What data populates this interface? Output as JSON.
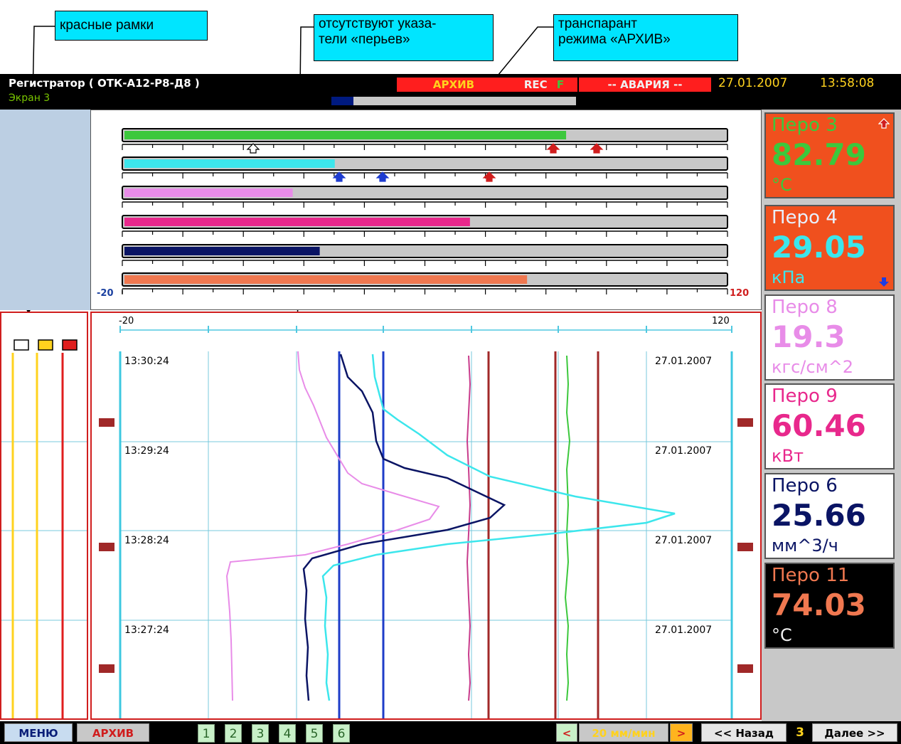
{
  "callouts": {
    "red_frames": "красные рамки",
    "no_pointers": "отсутствуют указа-\nтели «перьев»",
    "archive_banner": "транспарант\nрежима «АРХИВ»"
  },
  "header": {
    "title": "Регистратор ( ОТК-А12-Р8-Д8 )",
    "screen": "Экран 3",
    "archive": "АРХИВ",
    "rec": "REC",
    "rec_flag": "F",
    "alarm": "-- АВАРИЯ --",
    "date": "27.01.2007",
    "time": "13:58:08",
    "progress_fraction": 0.09
  },
  "bargraph": {
    "scale_min": "-20",
    "scale_max": "120",
    "bars": [
      {
        "name": "Перо 3",
        "color": "#3cc83c",
        "fraction": 0.735
      },
      {
        "name": "Перо 4",
        "color": "#3ce6ec",
        "fraction": 0.35
      },
      {
        "name": "Перо 8",
        "color": "#e88ce8",
        "fraction": 0.28
      },
      {
        "name": "Перо 9",
        "color": "#e8288c",
        "fraction": 0.575
      },
      {
        "name": "Перо 6",
        "color": "#0a1464",
        "fraction": 0.325
      },
      {
        "name": "Перо 11",
        "color": "#f07850",
        "fraction": 0.67
      }
    ]
  },
  "trend": {
    "scale_min": "-20",
    "scale_max": "120",
    "rows": [
      {
        "time": "13:30:24",
        "date": "27.01.2007"
      },
      {
        "time": "13:29:24",
        "date": "27.01.2007"
      },
      {
        "time": "13:28:24",
        "date": "27.01.2007"
      },
      {
        "time": "13:27:24",
        "date": "27.01.2007"
      }
    ]
  },
  "pens": [
    {
      "name": "Перо 3",
      "value": "82.79",
      "unit": "°C",
      "bg": "#f0501e",
      "fg": "#3cc83c"
    },
    {
      "name": "Перо 4",
      "value": "29.05",
      "unit": "кПа",
      "bg": "#f0501e",
      "fg": "#3ce6ec"
    },
    {
      "name": "Перо 8",
      "value": "19.3",
      "unit": "кгс/см^2",
      "bg": "#ffffff",
      "fg": "#e88ce8"
    },
    {
      "name": "Перо 9",
      "value": "60.46",
      "unit": "кВт",
      "bg": "#ffffff",
      "fg": "#e8288c"
    },
    {
      "name": "Перо 6",
      "value": "25.66",
      "unit": "мм^3/ч",
      "bg": "#ffffff",
      "fg": "#0a1464"
    },
    {
      "name": "Перо 11",
      "value": "74.03",
      "unit": "°C",
      "bg": "#000000",
      "fg": "#f07850"
    }
  ],
  "footer": {
    "menu": "МЕНЮ",
    "archive": "АРХИВ",
    "tabs": [
      "1",
      "2",
      "3",
      "4",
      "5",
      "6"
    ],
    "speed_dec": "<",
    "speed": "20 мм/мин",
    "speed_inc": ">",
    "back": "<< Назад",
    "page": "3",
    "next": "Далее >>"
  }
}
